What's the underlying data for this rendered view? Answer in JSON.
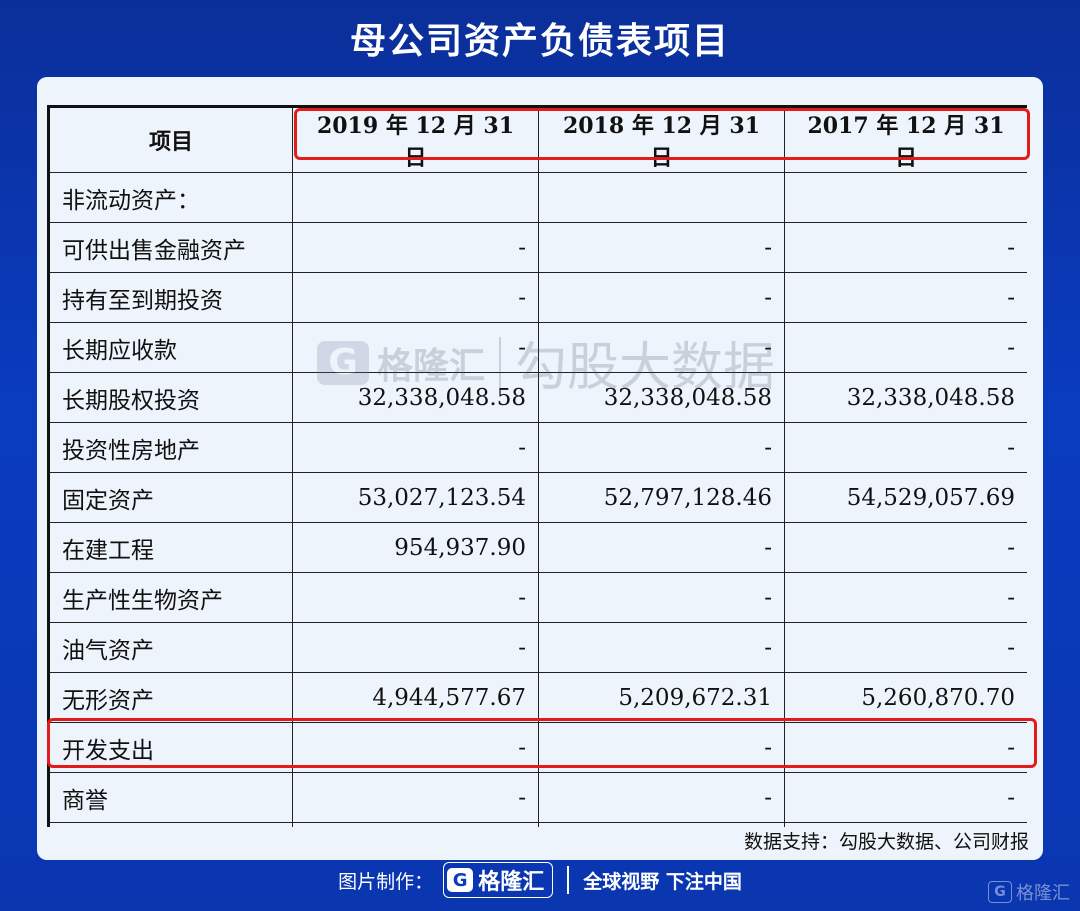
{
  "title": "母公司资产负债表项目",
  "table": {
    "headers": [
      "项目",
      "2019 年 12 月 31 日",
      "2018 年 12 月 31 日",
      "2017 年 12 月 31 日"
    ],
    "rows": [
      [
        "非流动资产：",
        "",
        "",
        ""
      ],
      [
        "可供出售金融资产",
        "-",
        "-",
        "-"
      ],
      [
        "持有至到期投资",
        "-",
        "-",
        "-"
      ],
      [
        "长期应收款",
        "-",
        "-",
        "-"
      ],
      [
        "长期股权投资",
        "32,338,048.58",
        "32,338,048.58",
        "32,338,048.58"
      ],
      [
        "投资性房地产",
        "-",
        "-",
        "-"
      ],
      [
        "固定资产",
        "53,027,123.54",
        "52,797,128.46",
        "54,529,057.69"
      ],
      [
        "在建工程",
        "954,937.90",
        "-",
        "-"
      ],
      [
        "生产性生物资产",
        "-",
        "-",
        "-"
      ],
      [
        "油气资产",
        "-",
        "-",
        "-"
      ],
      [
        "无形资产",
        "4,944,577.67",
        "5,209,672.31",
        "5,260,870.70"
      ],
      [
        "开发支出",
        "-",
        "-",
        "-"
      ],
      [
        "商誉",
        "-",
        "-",
        "-"
      ],
      [
        "",
        "",
        "",
        ""
      ]
    ]
  },
  "watermark": {
    "logo_letter": "G",
    "brand": "格隆汇",
    "text": "勾股大数据"
  },
  "source": "数据支持：勾股大数据、公司财报",
  "footer": {
    "prefix": "图片制作：",
    "logo_letter": "G",
    "brand": "格隆汇",
    "slogan": "全球视野 下注中国"
  },
  "corner": {
    "logo_letter": "G",
    "brand": "格隆汇"
  },
  "colors": {
    "background": "#0a3cc0",
    "card": "#eef4fb",
    "highlight": "#e21b1b"
  }
}
